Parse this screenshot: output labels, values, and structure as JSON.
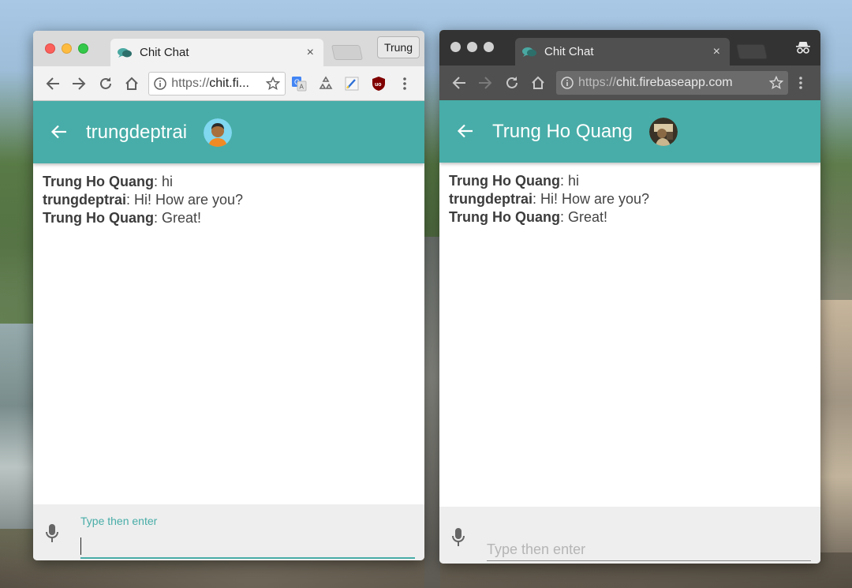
{
  "colors": {
    "accent": "#48ada8",
    "light_chrome": "#f2f2f2",
    "dark_chrome": "#505050"
  },
  "window_left": {
    "tab": {
      "title": "Chit Chat",
      "close": "×"
    },
    "profile_button": "Trung",
    "address": {
      "scheme": "https://",
      "rest": "chit.fi..."
    },
    "extensions": [
      "translate-icon",
      "recycle-icon",
      "notepad-icon",
      "ublock-icon"
    ],
    "appbar": {
      "title": "trungdeptrai"
    },
    "messages": [
      {
        "sender": "Trung Ho Quang",
        "text": ": hi"
      },
      {
        "sender": "trungdeptrai",
        "text": ": Hi! How are you?"
      },
      {
        "sender": "Trung Ho Quang",
        "text": ": Great!"
      }
    ],
    "composer": {
      "label": "Type then enter"
    }
  },
  "window_right": {
    "tab": {
      "title": "Chit Chat",
      "close": "×"
    },
    "address": {
      "scheme": "https://",
      "rest": "chit.firebaseapp.com"
    },
    "appbar": {
      "title": "Trung Ho Quang"
    },
    "messages": [
      {
        "sender": "Trung Ho Quang",
        "text": ": hi"
      },
      {
        "sender": "trungdeptrai",
        "text": ": Hi! How are you?"
      },
      {
        "sender": "Trung Ho Quang",
        "text": ": Great!"
      }
    ],
    "composer": {
      "placeholder": "Type then enter"
    }
  }
}
